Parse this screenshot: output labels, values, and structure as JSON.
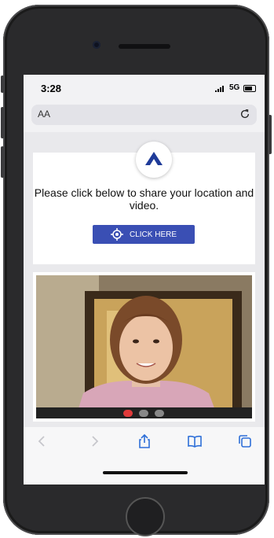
{
  "status_bar": {
    "time": "3:28",
    "network": "5G"
  },
  "address_bar": {
    "text_size_label": "AA"
  },
  "prompt_card": {
    "message": "Please click below to share your location and video.",
    "button_label": "CLICK HERE"
  },
  "colors": {
    "accent": "#3a4fb4",
    "logo": "#1f3b99"
  },
  "icons": [
    "back-icon",
    "forward-icon",
    "share-icon",
    "bookmarks-icon",
    "tabs-icon",
    "reload-icon",
    "location-icon"
  ]
}
